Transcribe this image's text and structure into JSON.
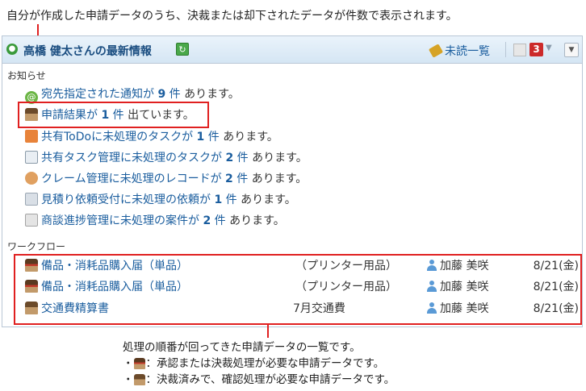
{
  "top_caption": "自分が作成した申請データのうち、決裁または却下されたデータが件数で表示されます。",
  "header": {
    "title": "高橋 健太さんの最新情報",
    "unread_label": "未読一覧",
    "badge_count": "3",
    "user_icon": "user-icon",
    "refresh_icon": "refresh-icon",
    "menu_icon": "chevron-down-icon"
  },
  "notices": {
    "section_label": "お知らせ",
    "items": [
      {
        "link": "宛先指定された通知が",
        "count": "9",
        "unit": "件",
        "suffix": "あります。",
        "icon": "at-icon"
      },
      {
        "link": "申請結果が",
        "count": "1",
        "unit": "件",
        "suffix": "出ています。",
        "icon": "stamp-icon"
      },
      {
        "link": "共有ToDoに未処理のタスクが",
        "count": "1",
        "unit": "件",
        "suffix": "あります。",
        "icon": "todo-icon"
      },
      {
        "link": "共有タスク管理に未処理のタスクが",
        "count": "2",
        "unit": "件",
        "suffix": "あります。",
        "icon": "task-icon"
      },
      {
        "link": "クレーム管理に未処理のレコードが",
        "count": "2",
        "unit": "件",
        "suffix": "あります。",
        "icon": "claim-icon"
      },
      {
        "link": "見積り依頼受付に未処理の依頼が",
        "count": "1",
        "unit": "件",
        "suffix": "あります。",
        "icon": "quote-icon"
      },
      {
        "link": "商談進捗管理に未処理の案件が",
        "count": "2",
        "unit": "件",
        "suffix": "あります。",
        "icon": "deal-icon"
      }
    ]
  },
  "workflow": {
    "section_label": "ワークフロー",
    "rows": [
      {
        "title": "備品・消耗品購入届（単品）",
        "subject": "（プリンター用品）",
        "user": "加藤 美咲",
        "date": "8/21(金)",
        "icon": "stamp-red-icon"
      },
      {
        "title": "備品・消耗品購入届（単品）",
        "subject": "（プリンター用品）",
        "user": "加藤 美咲",
        "date": "8/21(金)",
        "icon": "stamp-red-icon"
      },
      {
        "title": "交通費精算書",
        "subject": "7月交通費",
        "user": "加藤 美咲",
        "date": "8/21(金)",
        "icon": "stamp-icon"
      }
    ]
  },
  "bottom_caption": {
    "line1": "処理の順番が回ってきた申請データの一覧です。",
    "line2_prefix": "・",
    "line2": "：承認または決裁処理が必要な申請データです。",
    "line3_prefix": "・",
    "line3": "：決裁済みで、確認処理が必要な申請データです。"
  },
  "colors": {
    "link": "#1a5d9e",
    "highlight": "#e02020",
    "header_bg": "#d5e6f4",
    "badge": "#cc2a2a"
  }
}
